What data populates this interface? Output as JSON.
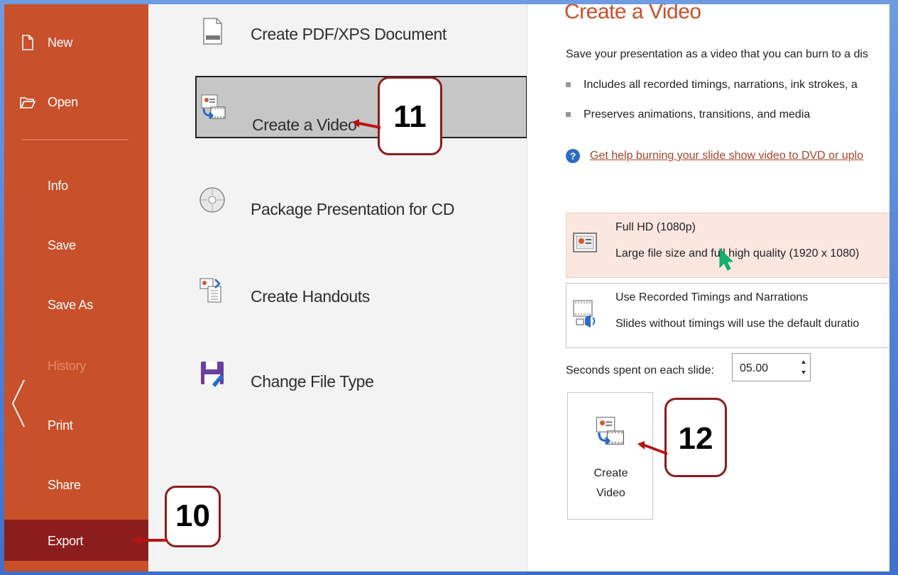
{
  "sidebar": {
    "items": [
      {
        "label": "New",
        "icon": "new-document-icon"
      },
      {
        "label": "Open",
        "icon": "open-folder-icon"
      },
      {
        "label": "Info"
      },
      {
        "label": "Save"
      },
      {
        "label": "Save As"
      },
      {
        "label": "History"
      },
      {
        "label": "Print"
      },
      {
        "label": "Share"
      },
      {
        "label": "Export"
      }
    ]
  },
  "middle": {
    "items": [
      {
        "label": "Create PDF/XPS Document",
        "icon": "pdf-document-icon"
      },
      {
        "label": "Create a Video",
        "icon": "video-icon"
      },
      {
        "label": "Package Presentation for CD",
        "icon": "cd-icon"
      },
      {
        "label": "Create Handouts",
        "icon": "handouts-icon"
      },
      {
        "label": "Change File Type",
        "icon": "save-floppy-icon"
      }
    ]
  },
  "right": {
    "title": "Create a Video",
    "description": "Save your presentation as a video that you can burn to a dis",
    "bullets": [
      "Includes all recorded timings, narrations, ink strokes, a",
      "Preserves animations, transitions, and media"
    ],
    "help_link": "Get help burning your slide show video to DVD or uplo",
    "quality": {
      "title": "Full HD (1080p)",
      "subtitle": "Large file size and full high quality (1920 x 1080)"
    },
    "timings": {
      "title": "Use Recorded Timings and Narrations",
      "subtitle": "Slides without timings will use the default duratio"
    },
    "seconds_label": "Seconds spent on each slide:",
    "seconds_value": "05.00",
    "create_button": {
      "line1": "Create",
      "line2": "Video"
    }
  },
  "callouts": [
    "10",
    "11",
    "12"
  ],
  "colors": {
    "sidebar": "#c8502a",
    "sidebar_active": "#8b1d1d",
    "accent": "#c8502a",
    "frame": "#4f7fd3"
  }
}
